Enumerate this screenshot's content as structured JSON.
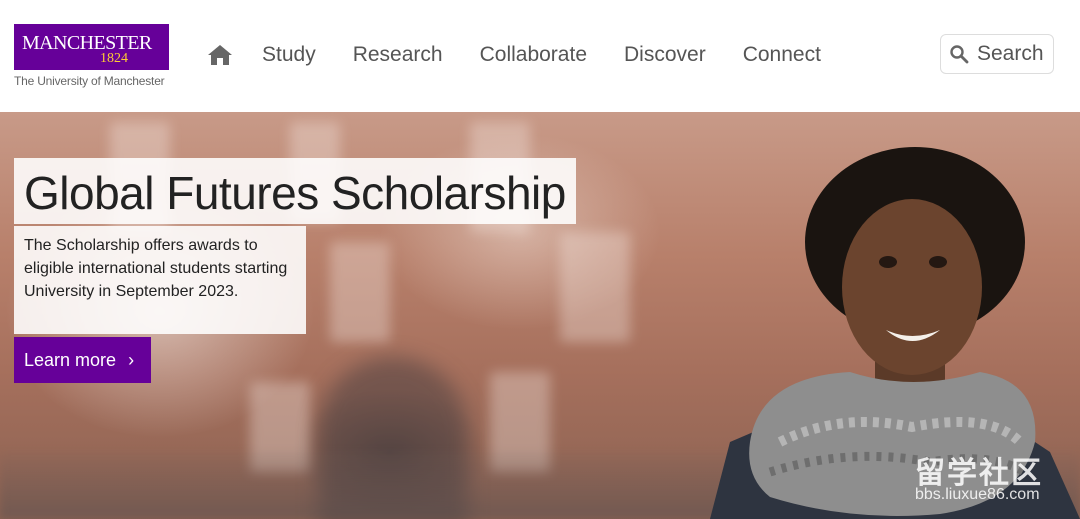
{
  "logo": {
    "wordmark": "MANCHESTER",
    "year": "1824",
    "subtitle": "The University of Manchester",
    "brand_color": "#660099"
  },
  "nav": {
    "home_icon": "home-icon",
    "items": [
      {
        "label": "Study"
      },
      {
        "label": "Research"
      },
      {
        "label": "Collaborate"
      },
      {
        "label": "Discover"
      },
      {
        "label": "Connect"
      }
    ]
  },
  "search": {
    "label": "Search",
    "icon": "search-icon"
  },
  "hero": {
    "title": "Global Futures Scholarship",
    "description": "The Scholarship offers awards to eligible international students starting University in September 2023.",
    "cta_label": "Learn more",
    "cta_arrow": "›"
  },
  "watermark": {
    "main": "留学社区",
    "url": "bbs.liuxue86.com"
  }
}
